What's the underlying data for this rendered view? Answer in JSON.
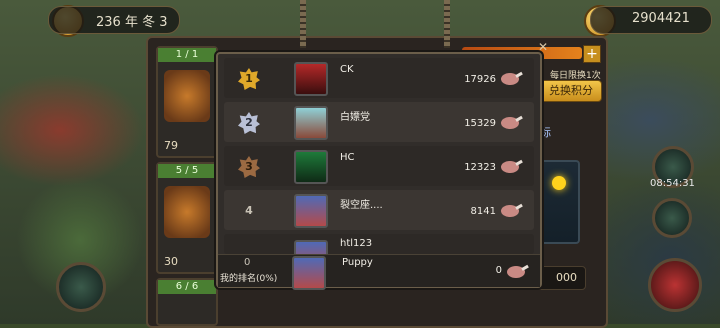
{
  "hud": {
    "year_text": "236 年 冬 3",
    "currency": "2904421",
    "top_right_note": "每日限换1次"
  },
  "shop": {
    "rows": [
      {
        "stock": "1 / 1",
        "price": "79"
      },
      {
        "stock": "5 / 5",
        "price": "30"
      },
      {
        "stock": "6 / 6",
        "price": ""
      }
    ],
    "daily_limit": "每日限换1次",
    "exchange_button": "兑换积分",
    "label_fragment": "标",
    "bottom_value": "000",
    "timer": "08:54:31"
  },
  "leaderboard": {
    "entries": [
      {
        "rank": "1",
        "name": "CK",
        "score": "17926",
        "badge": "gold",
        "avatar": "red"
      },
      {
        "rank": "2",
        "name": "白嫖党",
        "score": "15329",
        "badge": "silver",
        "avatar": "teal"
      },
      {
        "rank": "3",
        "name": "HC",
        "score": "12323",
        "badge": "bronze",
        "avatar": "green"
      },
      {
        "rank": "4",
        "name": "裂空座....",
        "score": "8141",
        "badge": "plain",
        "avatar": "blue"
      },
      {
        "rank": "",
        "name": "htl123",
        "score": "",
        "badge": "plain",
        "avatar": "blue"
      }
    ],
    "my_rank": {
      "rank": "0",
      "label": "我的排名(0%)",
      "name": "Puppy",
      "score": "0"
    }
  },
  "colors": {
    "panel": "#312d2a",
    "accent_gold": "#e0a92a",
    "button": "#f2c549"
  }
}
